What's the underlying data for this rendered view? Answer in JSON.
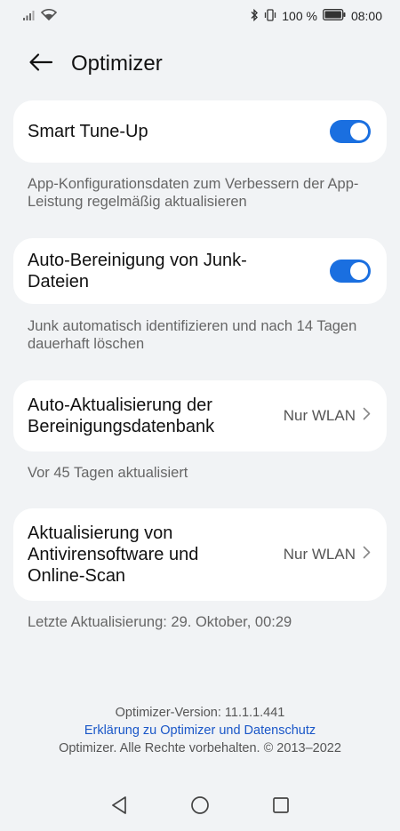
{
  "status_bar": {
    "battery_percent": "100 %",
    "time": "08:00"
  },
  "header": {
    "title": "Optimizer"
  },
  "settings": [
    {
      "title": "Smart Tune-Up",
      "toggle_on": true,
      "description": "App-Konfigurationsdaten zum Verbessern der App-Leistung regelmäßig aktualisieren"
    },
    {
      "title": "Auto-Bereinigung von Junk-Dateien",
      "toggle_on": true,
      "description": "Junk automatisch identifizieren und nach 14 Tagen dauerhaft löschen"
    },
    {
      "title": "Auto-Aktualisierung der Bereinigungsdatenbank",
      "value": "Nur WLAN",
      "description": "Vor 45 Tagen aktualisiert"
    },
    {
      "title": "Aktualisierung von Antivirensoftware und Online-Scan",
      "value": "Nur WLAN",
      "description": "Letzte Aktualisierung: 29. Oktober, 00:29"
    }
  ],
  "footer": {
    "version": "Optimizer-Version: 11.1.1.441",
    "privacy_link": "Erklärung zu Optimizer und Datenschutz",
    "copyright": "Optimizer. Alle Rechte vorbehalten. © 2013–2022"
  },
  "colors": {
    "accent": "#1a6fe0",
    "background": "#f1f3f5",
    "card": "#ffffff",
    "link": "#1a57c8"
  }
}
